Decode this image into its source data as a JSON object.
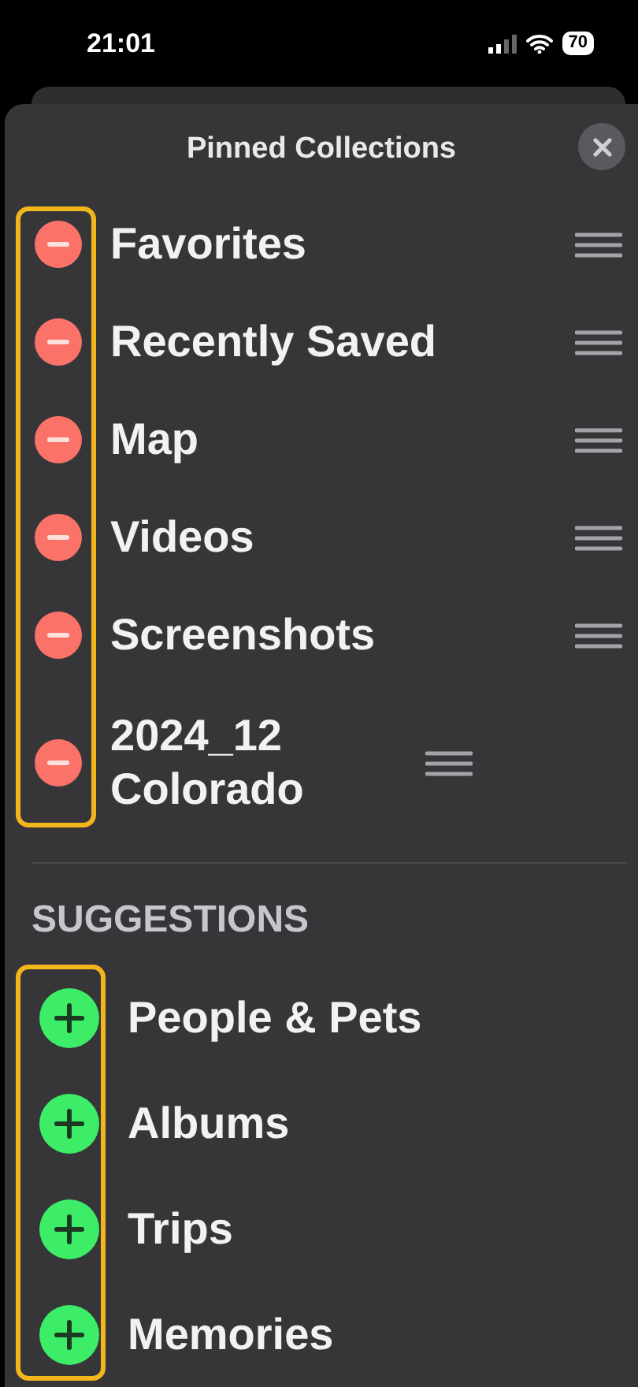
{
  "status_bar": {
    "time": "21:01",
    "battery": "70"
  },
  "sheet": {
    "title": "Pinned Collections"
  },
  "sections": [
    {
      "kind": "remove",
      "highlighted": true,
      "items": [
        {
          "label": "Favorites"
        },
        {
          "label": "Recently Saved"
        },
        {
          "label": "Map"
        },
        {
          "label": "Videos"
        },
        {
          "label": "Screenshots"
        },
        {
          "label": "2024_12 Colorado"
        }
      ]
    },
    {
      "kind": "add",
      "heading": "SUGGESTIONS",
      "highlighted": true,
      "items": [
        {
          "label": "People & Pets"
        },
        {
          "label": "Albums"
        },
        {
          "label": "Trips"
        },
        {
          "label": "Memories"
        }
      ]
    }
  ]
}
